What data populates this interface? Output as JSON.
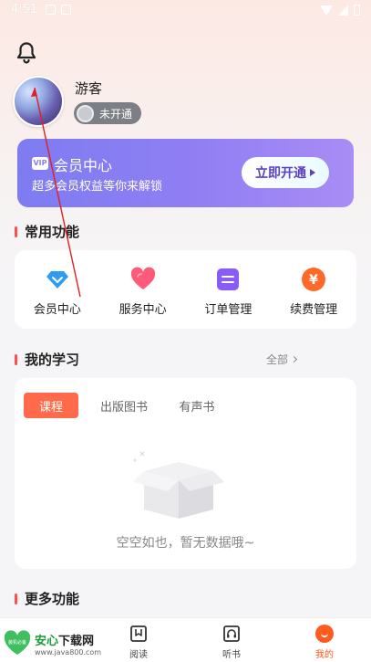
{
  "status_bar": {
    "time": "4:51"
  },
  "profile": {
    "username": "游客",
    "vip_status": "未开通"
  },
  "vip_card": {
    "badge": "VIP",
    "title": "会员中心",
    "subtitle": "超多会员权益等你来解锁",
    "button": "立即开通"
  },
  "common_functions": {
    "title": "常用功能",
    "items": [
      {
        "label": "会员中心",
        "icon": "diamond-icon",
        "color": "#2f9cf4"
      },
      {
        "label": "服务中心",
        "icon": "heart-icon",
        "color": "#ff5a7a"
      },
      {
        "label": "订单管理",
        "icon": "order-icon",
        "color": "#8a5cf6"
      },
      {
        "label": "续费管理",
        "icon": "yen-icon",
        "color": "#ff6a2a"
      }
    ]
  },
  "my_study": {
    "title": "我的学习",
    "see_all": "全部",
    "tabs": [
      "课程",
      "出版图书",
      "有声书"
    ],
    "empty_text": "空空如也，暂无数据哦~"
  },
  "more_functions": {
    "title": "更多功能"
  },
  "bottom_nav": {
    "items": [
      {
        "label": "阅读",
        "icon": "bookmark-icon"
      },
      {
        "label": "听书",
        "icon": "headphones-icon"
      },
      {
        "label": "我的",
        "icon": "me-icon"
      }
    ]
  },
  "watermark": {
    "brand_a": "安心",
    "brand_b": "下载网",
    "url": "www.java800.com",
    "logo_text": "装机必备"
  },
  "accent_color": "#ff4d4f"
}
